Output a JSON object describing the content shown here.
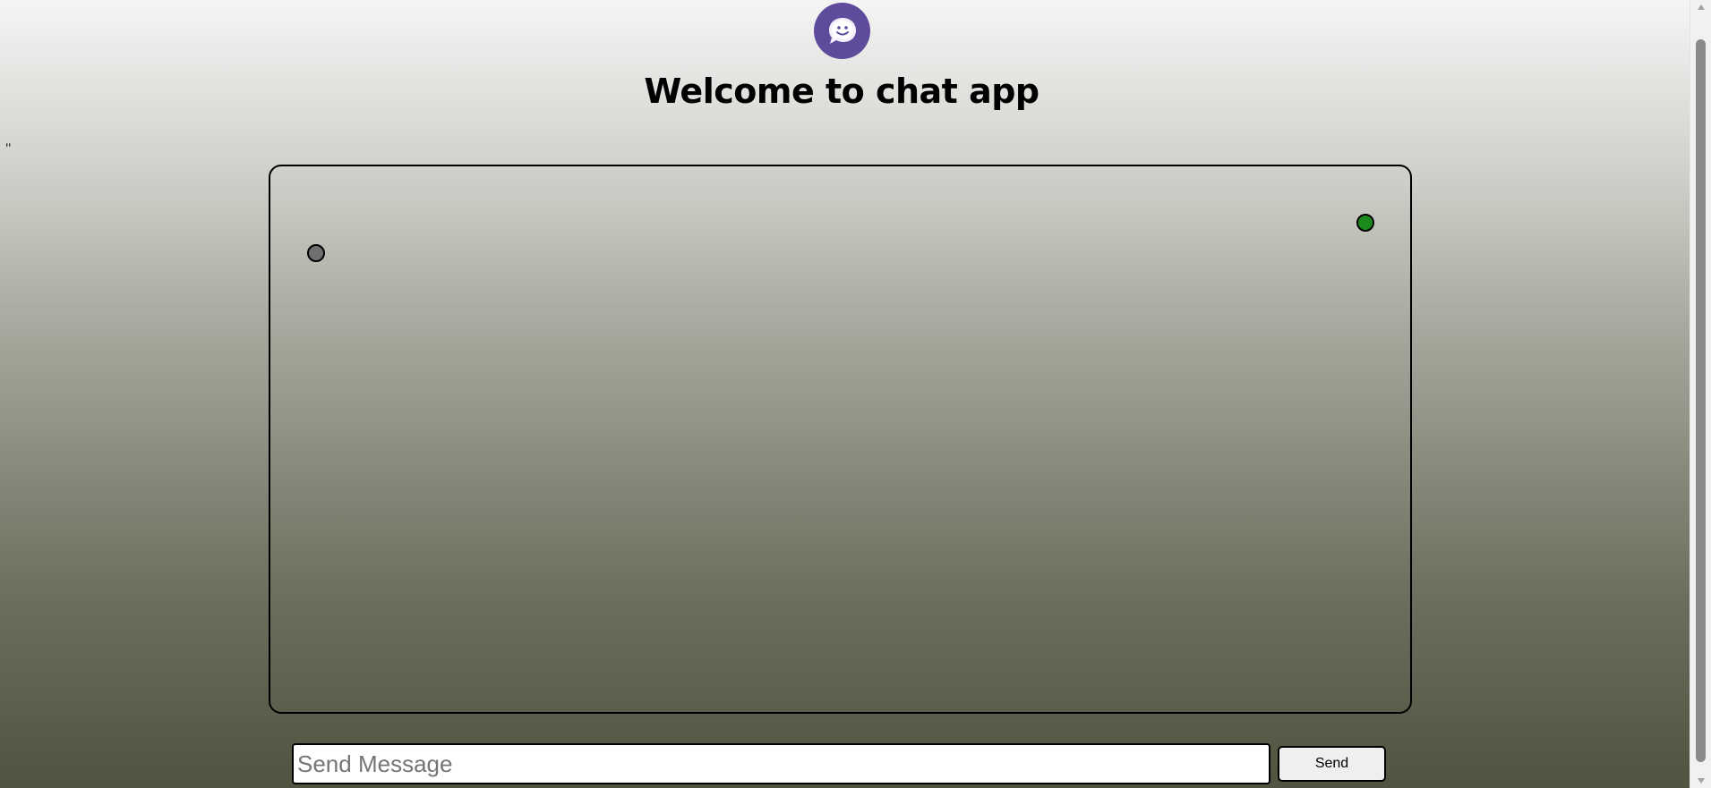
{
  "header": {
    "logo_icon": "chat-bubble-smile-icon",
    "title": "Welcome to chat app"
  },
  "stray_text": "\"",
  "chat": {
    "status_dots": [
      {
        "name": "gray-status-dot",
        "color": "#6f6f6f"
      },
      {
        "name": "green-status-dot",
        "color": "#1b8a1b"
      }
    ]
  },
  "composer": {
    "input_value": "",
    "input_placeholder": "Send Message",
    "send_label": "Send"
  },
  "colors": {
    "logo_background": "#5f4b9b",
    "online_green": "#1b8a1b"
  }
}
